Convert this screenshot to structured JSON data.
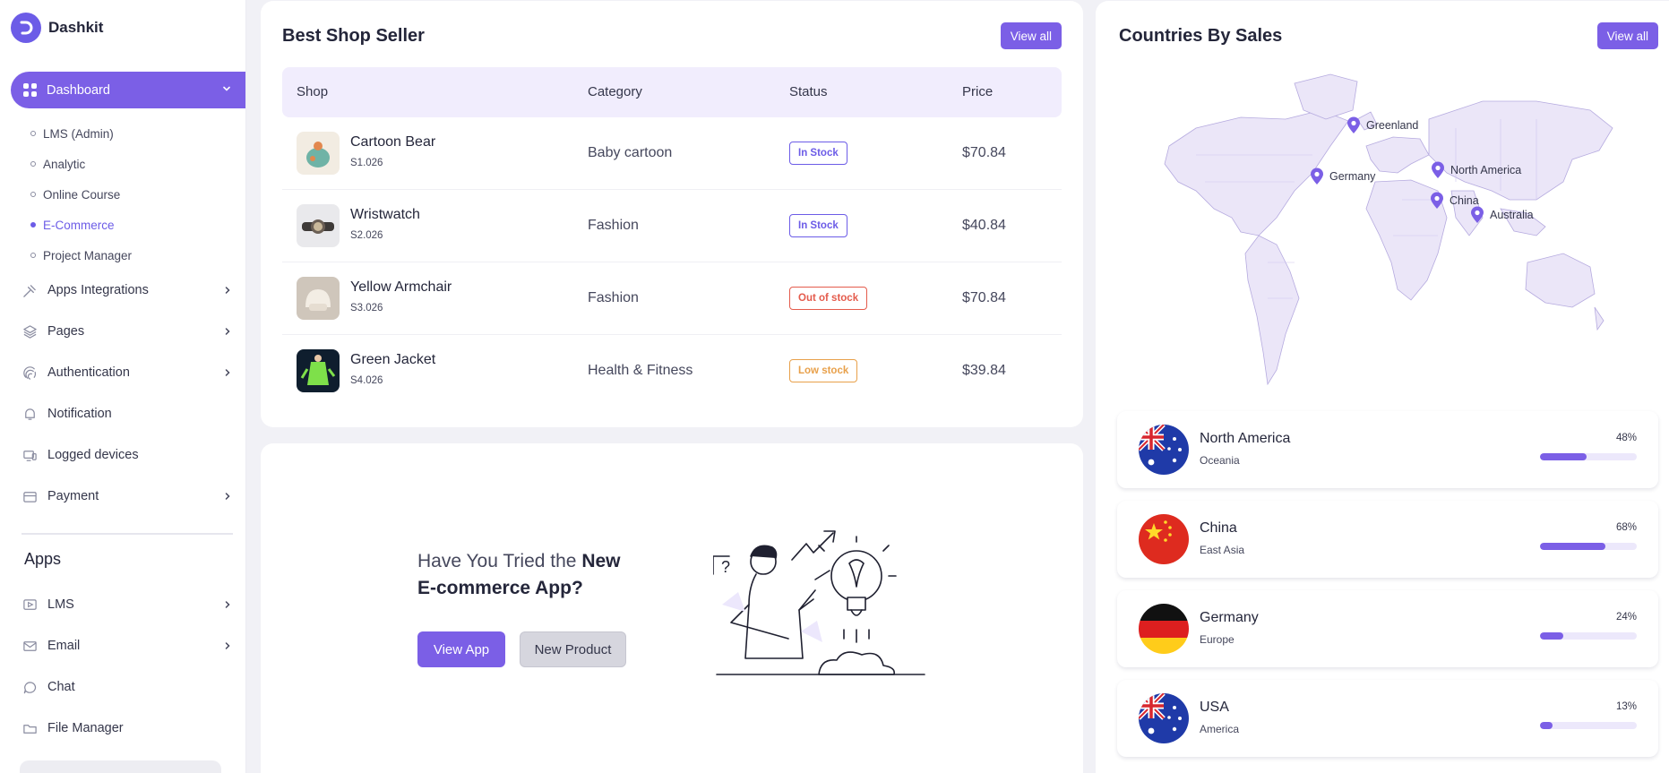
{
  "brand": {
    "name": "Dashkit"
  },
  "sidebar": {
    "main_item": "Dashboard",
    "subitems": [
      "LMS (Admin)",
      "Analytic",
      "Online Course",
      "E-Commerce",
      "Project Manager"
    ],
    "active_subitem": "E-Commerce",
    "items": [
      {
        "label": "Apps Integrations",
        "icon": "puzzle-icon",
        "has_chevron": true
      },
      {
        "label": "Pages",
        "icon": "layers-icon",
        "has_chevron": true
      },
      {
        "label": "Authentication",
        "icon": "fingerprint-icon",
        "has_chevron": true
      },
      {
        "label": "Notification",
        "icon": "bell-icon",
        "has_chevron": false
      },
      {
        "label": "Logged devices",
        "icon": "devices-icon",
        "has_chevron": false
      },
      {
        "label": "Payment",
        "icon": "wallet-icon",
        "has_chevron": true
      }
    ],
    "apps_title": "Apps",
    "apps_items": [
      {
        "label": "LMS",
        "icon": "video-icon",
        "has_chevron": true
      },
      {
        "label": "Email",
        "icon": "mail-icon",
        "has_chevron": true
      },
      {
        "label": "Chat",
        "icon": "chat-icon",
        "has_chevron": false
      },
      {
        "label": "File Manager",
        "icon": "folder-icon",
        "has_chevron": false
      }
    ]
  },
  "best_seller": {
    "title": "Best Shop Seller",
    "view_all": "View all",
    "columns": [
      "Shop",
      "Category",
      "Status",
      "Price"
    ],
    "rows": [
      {
        "name": "Cartoon Bear",
        "sku": "S1.026",
        "category": "Baby cartoon",
        "status": "In Stock",
        "status_type": "instock",
        "price": "$70.84"
      },
      {
        "name": "Wristwatch",
        "sku": "S2.026",
        "category": "Fashion",
        "status": "In Stock",
        "status_type": "instock",
        "price": "$40.84"
      },
      {
        "name": "Yellow Armchair",
        "sku": "S3.026",
        "category": "Fashion",
        "status": "Out of stock",
        "status_type": "out",
        "price": "$70.84"
      },
      {
        "name": "Green Jacket",
        "sku": "S4.026",
        "category": "Health & Fitness",
        "status": "Low stock",
        "status_type": "low",
        "price": "$39.84"
      }
    ]
  },
  "promo": {
    "text_regular": "Have You Tried the ",
    "text_bold": "New E-commerce App?",
    "primary_button": "View App",
    "secondary_button": "New Product"
  },
  "countries": {
    "title": "Countries By Sales",
    "view_all": "View all",
    "map_pins": [
      "Greenland",
      "Germany",
      "North America",
      "China",
      "Australia"
    ],
    "list": [
      {
        "name": "North America",
        "region": "Oceania",
        "percent": "48%",
        "value": 48,
        "flag": "australia"
      },
      {
        "name": "China",
        "region": "East Asia",
        "percent": "68%",
        "value": 68,
        "flag": "china"
      },
      {
        "name": "Germany",
        "region": "Europe",
        "percent": "24%",
        "value": 24,
        "flag": "germany"
      },
      {
        "name": "USA",
        "region": "America",
        "percent": "13%",
        "value": 13,
        "flag": "australia"
      }
    ]
  },
  "colors": {
    "accent": "#7b5fe6",
    "in_stock": "#6c5ce7",
    "out_of_stock": "#e45b4c",
    "low_stock": "#e8a04a"
  }
}
